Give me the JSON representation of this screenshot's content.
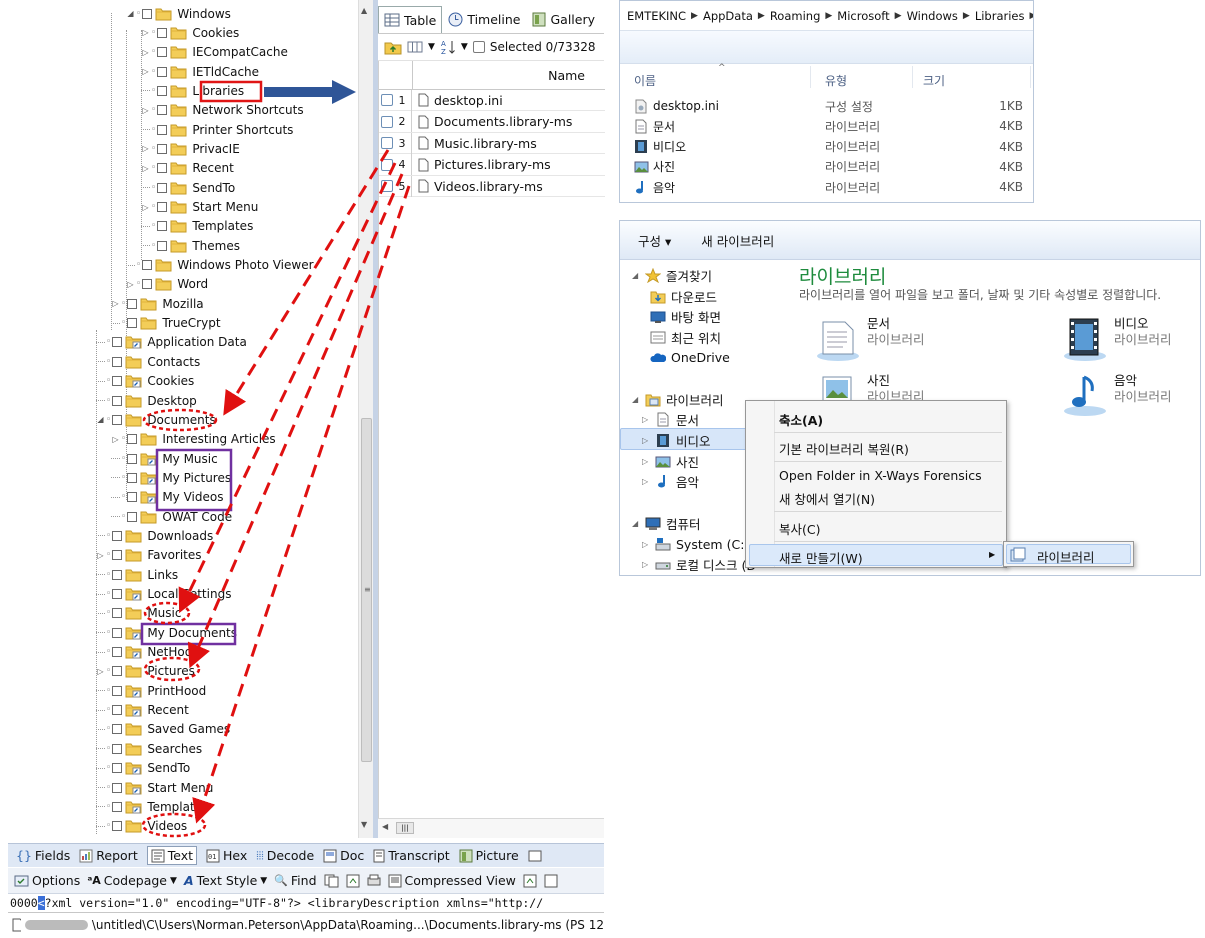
{
  "tree": {
    "items": [
      {
        "label": "Windows",
        "indent": 2,
        "exp": "open",
        "cb": "round"
      },
      {
        "label": "Cookies",
        "indent": 3,
        "exp": "closed",
        "cb": "round"
      },
      {
        "label": "IECompatCache",
        "indent": 3,
        "exp": "closed",
        "cb": "round"
      },
      {
        "label": "IETldCache",
        "indent": 3,
        "exp": "closed",
        "cb": "round"
      },
      {
        "label": "Libraries",
        "indent": 3,
        "exp": "none",
        "cb": "round"
      },
      {
        "label": "Network Shortcuts",
        "indent": 3,
        "exp": "closed",
        "cb": "round"
      },
      {
        "label": "Printer Shortcuts",
        "indent": 3,
        "exp": "none",
        "cb": "round"
      },
      {
        "label": "PrivacIE",
        "indent": 3,
        "exp": "closed",
        "cb": "round"
      },
      {
        "label": "Recent",
        "indent": 3,
        "exp": "closed",
        "cb": "round"
      },
      {
        "label": "SendTo",
        "indent": 3,
        "exp": "none",
        "cb": "round"
      },
      {
        "label": "Start Menu",
        "indent": 3,
        "exp": "closed",
        "cb": "round"
      },
      {
        "label": "Templates",
        "indent": 3,
        "exp": "none",
        "cb": "round"
      },
      {
        "label": "Themes",
        "indent": 3,
        "exp": "none",
        "cb": "round"
      },
      {
        "label": "Windows Photo Viewer",
        "indent": 2,
        "exp": "none",
        "cb": "round"
      },
      {
        "label": "Word",
        "indent": 2,
        "exp": "closed",
        "cb": "round"
      },
      {
        "label": "Mozilla",
        "indent": 1,
        "exp": "closed",
        "cb": "round"
      },
      {
        "label": "TrueCrypt",
        "indent": 1,
        "exp": "none",
        "cb": "round"
      },
      {
        "label": "Application Data",
        "indent": 0,
        "exp": "none",
        "cb": "round",
        "lnk": true
      },
      {
        "label": "Contacts",
        "indent": 0,
        "exp": "none",
        "cb": "round"
      },
      {
        "label": "Cookies",
        "indent": 0,
        "exp": "none",
        "cb": "round",
        "lnk": true
      },
      {
        "label": "Desktop",
        "indent": 0,
        "exp": "none",
        "cb": "round"
      },
      {
        "label": "Documents",
        "indent": 0,
        "exp": "open",
        "cb": "round"
      },
      {
        "label": "Interesting Articles",
        "indent": 1,
        "exp": "closed",
        "cb": "round"
      },
      {
        "label": "My Music",
        "indent": 1,
        "exp": "none",
        "cb": "round",
        "lnk": true
      },
      {
        "label": "My Pictures",
        "indent": 1,
        "exp": "none",
        "cb": "round",
        "lnk": true
      },
      {
        "label": "My Videos",
        "indent": 1,
        "exp": "none",
        "cb": "round",
        "lnk": true
      },
      {
        "label": "OWAT Code",
        "indent": 1,
        "exp": "none",
        "cb": "round"
      },
      {
        "label": "Downloads",
        "indent": 0,
        "exp": "none",
        "cb": "round"
      },
      {
        "label": "Favorites",
        "indent": 0,
        "exp": "closed",
        "cb": "round"
      },
      {
        "label": "Links",
        "indent": 0,
        "exp": "none",
        "cb": "round"
      },
      {
        "label": "Local Settings",
        "indent": 0,
        "exp": "none",
        "cb": "round",
        "lnk": true
      },
      {
        "label": "Music",
        "indent": 0,
        "exp": "none",
        "cb": "round"
      },
      {
        "label": "My Documents",
        "indent": 0,
        "exp": "none",
        "cb": "round",
        "lnk": true
      },
      {
        "label": "NetHood",
        "indent": 0,
        "exp": "none",
        "cb": "round",
        "lnk": true
      },
      {
        "label": "Pictures",
        "indent": 0,
        "exp": "closed",
        "cb": "round"
      },
      {
        "label": "PrintHood",
        "indent": 0,
        "exp": "none",
        "cb": "round",
        "lnk": true
      },
      {
        "label": "Recent",
        "indent": 0,
        "exp": "none",
        "cb": "round",
        "lnk": true
      },
      {
        "label": "Saved Games",
        "indent": 0,
        "exp": "none",
        "cb": "round"
      },
      {
        "label": "Searches",
        "indent": 0,
        "exp": "none",
        "cb": "round"
      },
      {
        "label": "SendTo",
        "indent": 0,
        "exp": "none",
        "cb": "round",
        "lnk": true
      },
      {
        "label": "Start Menu",
        "indent": 0,
        "exp": "none",
        "cb": "round",
        "lnk": true
      },
      {
        "label": "Templates",
        "indent": 0,
        "exp": "none",
        "cb": "round",
        "lnk": true
      },
      {
        "label": "Videos",
        "indent": 0,
        "exp": "none",
        "cb": "round"
      }
    ]
  },
  "tabs": {
    "table": "Table",
    "timeline": "Timeline",
    "gallery": "Gallery"
  },
  "toolbar": {
    "selected": "Selected 0/73328"
  },
  "table": {
    "col_name": "Name",
    "rows": [
      {
        "num": "1",
        "name": "desktop.ini"
      },
      {
        "num": "2",
        "name": "Documents.library-ms"
      },
      {
        "num": "3",
        "name": "Music.library-ms"
      },
      {
        "num": "4",
        "name": "Pictures.library-ms"
      },
      {
        "num": "5",
        "name": "Videos.library-ms"
      }
    ]
  },
  "view_tabs": [
    "Fields",
    "Report",
    "Text",
    "Hex",
    "Decode",
    "Doc",
    "Transcript",
    "Picture"
  ],
  "options_bar": {
    "options": "Options",
    "codepage": "Codepage",
    "text_style": "Text Style",
    "find": "Find",
    "compressed": "Compressed View"
  },
  "xml_line": {
    "offset": "0000",
    "text": "?xml version=\"1.0\" encoding=\"UTF-8\"?>  <libraryDescription xmlns=\"http://"
  },
  "status_path": "\\untitled\\C\\Users\\Norman.Peterson\\AppData\\Roaming...\\Documents.library-ms (PS 12",
  "explorer_top": {
    "breadcrumb": [
      "EMTEKINC",
      "AppData",
      "Roaming",
      "Microsoft",
      "Windows",
      "Libraries"
    ],
    "headers": {
      "name": "이름",
      "type": "유형",
      "size": "크기"
    },
    "rows": [
      {
        "name": "desktop.ini",
        "type": "구성 설정",
        "size": "1KB",
        "icon": "ini"
      },
      {
        "name": "문서",
        "type": "라이브러리",
        "size": "4KB",
        "icon": "doc"
      },
      {
        "name": "비디오",
        "type": "라이브러리",
        "size": "4KB",
        "icon": "video"
      },
      {
        "name": "사진",
        "type": "라이브러리",
        "size": "4KB",
        "icon": "pic"
      },
      {
        "name": "음악",
        "type": "라이브러리",
        "size": "4KB",
        "icon": "music"
      }
    ]
  },
  "explorer_bottom": {
    "toolbar": {
      "organize": "구성 ▾",
      "new_library": "새 라이브러리"
    },
    "nav": {
      "favorites": "즐겨찾기",
      "fav_items": [
        "다운로드",
        "바탕 화면",
        "최근 위치",
        "OneDrive"
      ],
      "libraries": "라이브러리",
      "lib_items": [
        "문서",
        "비디오",
        "사진",
        "음악"
      ],
      "computer": "컴퓨터",
      "drives": [
        "System (C:)",
        "로컬 디스크 (D"
      ]
    },
    "title": "라이브러리",
    "description": "라이브러리를 열어 파일을 보고 폴더, 날짜 및 기타 속성별로 정렬합니다.",
    "items": [
      {
        "name": "문서",
        "sub": "라이브러리"
      },
      {
        "name": "비디오",
        "sub": "라이브러리"
      },
      {
        "name": "사진",
        "sub": "라이브러리"
      },
      {
        "name": "음악",
        "sub": "라이브러리"
      }
    ],
    "context_menu": [
      "축소(A)",
      "기본 라이브러리 복원(R)",
      "Open Folder in X-Ways Forensics",
      "새 창에서 열기(N)",
      "복사(C)",
      "새로 만들기(W)"
    ],
    "submenu": "라이브러리"
  },
  "colors": {
    "red_box": "#e01515",
    "purple_box": "#7030a0",
    "arrow_blue": "#2f5597",
    "dashed_red": "#e01010"
  }
}
